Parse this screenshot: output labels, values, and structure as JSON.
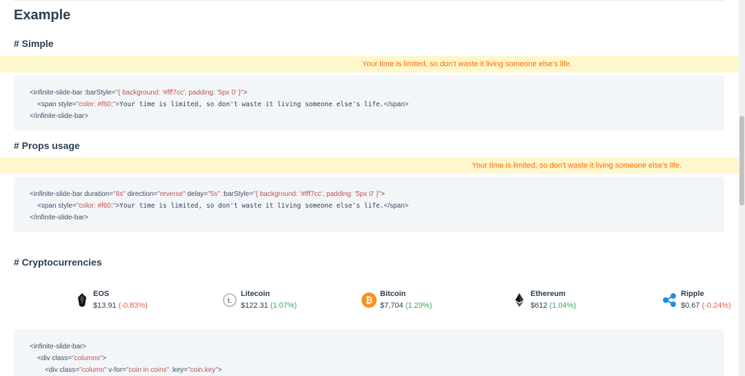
{
  "heading": "Example",
  "sections": {
    "simple": "# Simple",
    "props": "# Props usage",
    "crypto": "# Cryptocurrencies"
  },
  "banner_text": "Your time is limited, so don't waste it living someone else's life.",
  "code_simple": {
    "l1_tag": "<infinite-slide-bar ",
    "l1_attr": ":barStyle=",
    "l1_val": "\"{ background: '#fff7cc', padding: '5px 0' }\"",
    "l1_close": ">",
    "l2_tag": "<span ",
    "l2_attr": "style=",
    "l2_val": "\"color: #f60;\"",
    "l2_close": ">",
    "l2_text": "Your time is limited, so don't waste it living someone else's life.",
    "l2_end": "</span>",
    "l3": "</infinite-slide-bar>"
  },
  "code_props": {
    "l1_tag": "<infinite-slide-bar ",
    "a1": "duration=",
    "v1": "\"8s\"",
    "a2": " direction=",
    "v2": "\"reverse\"",
    "a3": " delay=",
    "v3": "\"5s\"",
    "a4": " :barStyle=",
    "v4": "\"{ background: '#fff7cc', padding: '5px 0' }\"",
    "l1_close": ">",
    "l2_tag": "<span ",
    "l2_attr": "style=",
    "l2_val": "\"color: #f60;\"",
    "l2_close": ">",
    "l2_text": "Your time is limited, so don't waste it living someone else's life.",
    "l2_end": "</span>",
    "l3": "</infinite-slide-bar>"
  },
  "code_crypto": {
    "l1": "<infinite-slide-bar>",
    "l2_tag": "<div ",
    "l2_attr": "class=",
    "l2_val": "\"columns\"",
    "l2_close": ">",
    "l3_tag": "<div ",
    "l3_a1": "class=",
    "l3_v1": "\"column\"",
    "l3_a2": " v-for=",
    "l3_v2": "\"coin in coins\"",
    "l3_a3": " :key=",
    "l3_v3": "\"coin.key\"",
    "l3_close": ">"
  },
  "coins": [
    {
      "name": "EOS",
      "price": "$13.91",
      "change": "(-0.83%)",
      "icon": "eos-icon"
    },
    {
      "name": "Litecoin",
      "price": "$122.31",
      "change": "(1.07%)",
      "icon": "litecoin-icon"
    },
    {
      "name": "Bitcoin",
      "price": "$7,704",
      "change": "(1.29%)",
      "icon": "bitcoin-icon"
    },
    {
      "name": "Ethereum",
      "price": "$612",
      "change": "(1.04%)",
      "icon": "ethereum-icon"
    },
    {
      "name": "Ripple",
      "price": "$0.67",
      "change": "(-0.24%)",
      "icon": "ripple-icon"
    }
  ],
  "colors": {
    "banner_bg": "#fff7cc",
    "banner_text": "#ff6600",
    "code_bg": "#f3f6f9",
    "positive": "#3aa55a",
    "negative": "#e05a4b",
    "bitcoin": "#f7931a"
  }
}
